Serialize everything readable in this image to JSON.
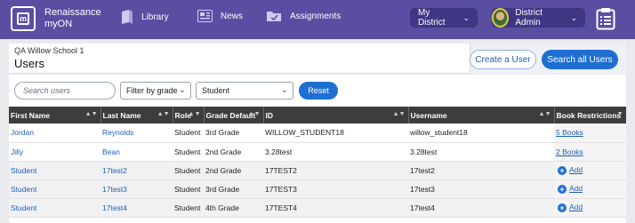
{
  "app": {
    "logo_line1": "Renaissance",
    "logo_line2": "myON"
  },
  "nav": {
    "library": "Library",
    "news": "News",
    "assignments": "Assignments",
    "district": "My District",
    "user": "District Admin"
  },
  "header": {
    "school": "QA Willow School 1",
    "title": "Users",
    "create_user": "Create a User",
    "search_all": "Search all Users"
  },
  "filters": {
    "search_placeholder": "Search users",
    "grade_filter": "Filter by grade",
    "role": "Student",
    "reset": "Reset"
  },
  "table": {
    "columns": [
      "First Name",
      "Last Name",
      "Role",
      "Grade Default",
      "ID",
      "Username",
      "Book Restrictions"
    ],
    "rows": [
      {
        "first": "Jordan",
        "last": "Reynolds",
        "role": "Student",
        "grade": "3rd Grade",
        "id": "WILLOW_STUDENT18",
        "username": "willow_student18",
        "restriction": "5 Books"
      },
      {
        "first": "Jilly",
        "last": "Bean",
        "role": "Student",
        "grade": "2nd Grade",
        "id": "3.28test",
        "username": "3.28test",
        "restriction": "2 Books"
      },
      {
        "first": "Student",
        "last": "17test2",
        "role": "Student",
        "grade": "2nd Grade",
        "id": "17TEST2",
        "username": "17test2",
        "restriction": "Add"
      },
      {
        "first": "Student",
        "last": "17test3",
        "role": "Student",
        "grade": "3rd Grade",
        "id": "17TEST3",
        "username": "17test3",
        "restriction": "Add"
      },
      {
        "first": "Student",
        "last": "17test4",
        "role": "Student",
        "grade": "4th Grade",
        "id": "17TEST4",
        "username": "17test4",
        "restriction": "Add"
      }
    ]
  },
  "colors": {
    "nav_bg": "#5a4ea3",
    "primary": "#1f6fd1",
    "link": "#1f5fb5",
    "table_header": "#3d3d3d"
  }
}
